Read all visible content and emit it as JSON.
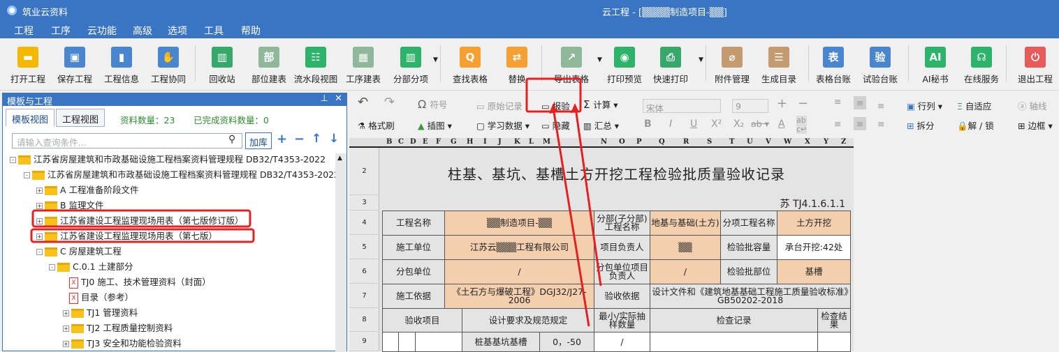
{
  "app": {
    "name": "筑业云资料",
    "window_title": "云工程 - [▒▒▒▒制造项目-▒▒]"
  },
  "menu": [
    "工程",
    "工序",
    "云功能",
    "高级",
    "选项",
    "工具",
    "帮助"
  ],
  "toolbar": [
    {
      "label": "打开工程",
      "icon": "folder-open-icon",
      "color": "#f5b800"
    },
    {
      "label": "保存工程",
      "icon": "save-icon",
      "color": "#4a86d0"
    },
    {
      "label": "工程信息",
      "icon": "building-icon",
      "color": "#4a86d0"
    },
    {
      "label": "工程协同",
      "icon": "handshake-icon",
      "color": "#4a86d0"
    },
    {
      "label": "回收站",
      "icon": "trash-icon",
      "color": "#36a86a"
    },
    {
      "label": "部位建表",
      "icon": "table-icon",
      "color": "#8fb79a"
    },
    {
      "label": "流水段视图",
      "icon": "tree-view-icon",
      "color": "#2eb36a"
    },
    {
      "label": "工序建表",
      "icon": "table-add-icon",
      "color": "#8fb79a"
    },
    {
      "label": "分部分项",
      "icon": "bar-chart-icon",
      "color": "#2eb36a"
    },
    {
      "label": "查找表格",
      "icon": "search-icon",
      "color": "#f5a030"
    },
    {
      "label": "替换",
      "icon": "replace-icon",
      "color": "#f5a030"
    },
    {
      "label": "导出表格",
      "icon": "export-icon",
      "color": "#8fb79a"
    },
    {
      "label": "打印预览",
      "icon": "eye-icon",
      "color": "#2eb36a"
    },
    {
      "label": "快速打印",
      "icon": "printer-icon",
      "color": "#36a86a"
    },
    {
      "label": "附件管理",
      "icon": "paperclip-icon",
      "color": "#c59a70"
    },
    {
      "label": "生成目录",
      "icon": "list-icon",
      "color": "#c59a70"
    },
    {
      "label": "表格台账",
      "icon": "ledger-icon",
      "color": "#4a86d0"
    },
    {
      "label": "试验台账",
      "icon": "test-ledger-icon",
      "color": "#4a86d0"
    },
    {
      "label": "AI秘书",
      "icon": "ai-icon",
      "color": "#2eb36a"
    },
    {
      "label": "在线服务",
      "icon": "headset-icon",
      "color": "#2eb36a"
    },
    {
      "label": "退出工程",
      "icon": "power-icon",
      "color": "#e85a5a"
    }
  ],
  "left_panel": {
    "title": "模板与工程",
    "tabs": [
      "模板视图",
      "工程视图"
    ],
    "count_label": "资料数量：23",
    "done_label": "已完成资料数量：0",
    "search_placeholder": "请输入查询条件...",
    "add_lib": "加库",
    "tree": [
      "江苏省房屋建筑和市政基础设施工程档案资料管理规程 DB32/T4353-2022",
      "江苏省房屋建筑和市政基础设施工程档案资料管理规程 DB32/T4353-2022",
      "A 工程准备阶段文件",
      "B 监理文件",
      "江苏省建设工程监理现场用表（第七版修订版）",
      "江苏省建设工程监理现场用表（第七版）",
      "C 房屋建筑工程",
      "C.0.1 土建部分",
      "TJ0 施工、技术管理资料（封面）",
      "目录（参考）",
      "TJ1 管理资料",
      "TJ2 工程质量控制资料",
      "TJ3 安全和功能检验资料"
    ]
  },
  "format_bar": {
    "undo": "↶",
    "redo": "↷",
    "symbol": "符号",
    "original": "原始记录",
    "inspect": "报验",
    "calc": "计算",
    "painter": "格式刷",
    "insert_img": "插图",
    "study": "学习数据",
    "hide": "隐藏",
    "sum": "汇总",
    "font": "宋体",
    "size": "9",
    "rowcol": "行列",
    "autofit": "自适应",
    "split": "拆分",
    "lock": "解 / 锁",
    "axis": "轴线",
    "border": "边框"
  },
  "columns": [
    "B",
    "C",
    "D",
    "E",
    "F",
    "G",
    "H",
    "I",
    "J",
    "K",
    "L",
    "M",
    "N",
    "O",
    "P",
    "Q",
    "R",
    "S",
    "T",
    "U",
    "V",
    "W",
    "X",
    "Y",
    "Z"
  ],
  "rows": [
    "2",
    "3",
    "4",
    "5",
    "6",
    "7",
    "8",
    "9"
  ],
  "sheet": {
    "title": "柱基、基坑、基槽土方开挖工程检验批质量验收记录",
    "code": "苏 TJ4.1.6.1.1",
    "r4": [
      "工程名称",
      "▒▒制造项目-▒▒",
      "分部(子分部)工程名称",
      "地基与基础(土方)",
      "分项工程名称",
      "土方开挖"
    ],
    "r5": [
      "施工单位",
      "江苏云▒▒▒工程有限公司",
      "项目负责人",
      "▒▒",
      "检验批容量",
      "承台开挖:42处"
    ],
    "r6": [
      "分包单位",
      "/",
      "分包单位项目负责人",
      "/",
      "检验批部位",
      "基槽"
    ],
    "r7": [
      "施工依据",
      "《土石方与爆破工程》DGJ32/J27-2006",
      "验收依据",
      "设计文件和《建筑地基基础工程施工质量验收标准》GB50202-2018"
    ],
    "r8": [
      "验收项目",
      "设计要求及规范规定",
      "最小/实际抽样数量",
      "检查记录",
      "检查结果"
    ],
    "r9": [
      "桩基基坑基槽",
      "0，-50",
      "/"
    ]
  }
}
